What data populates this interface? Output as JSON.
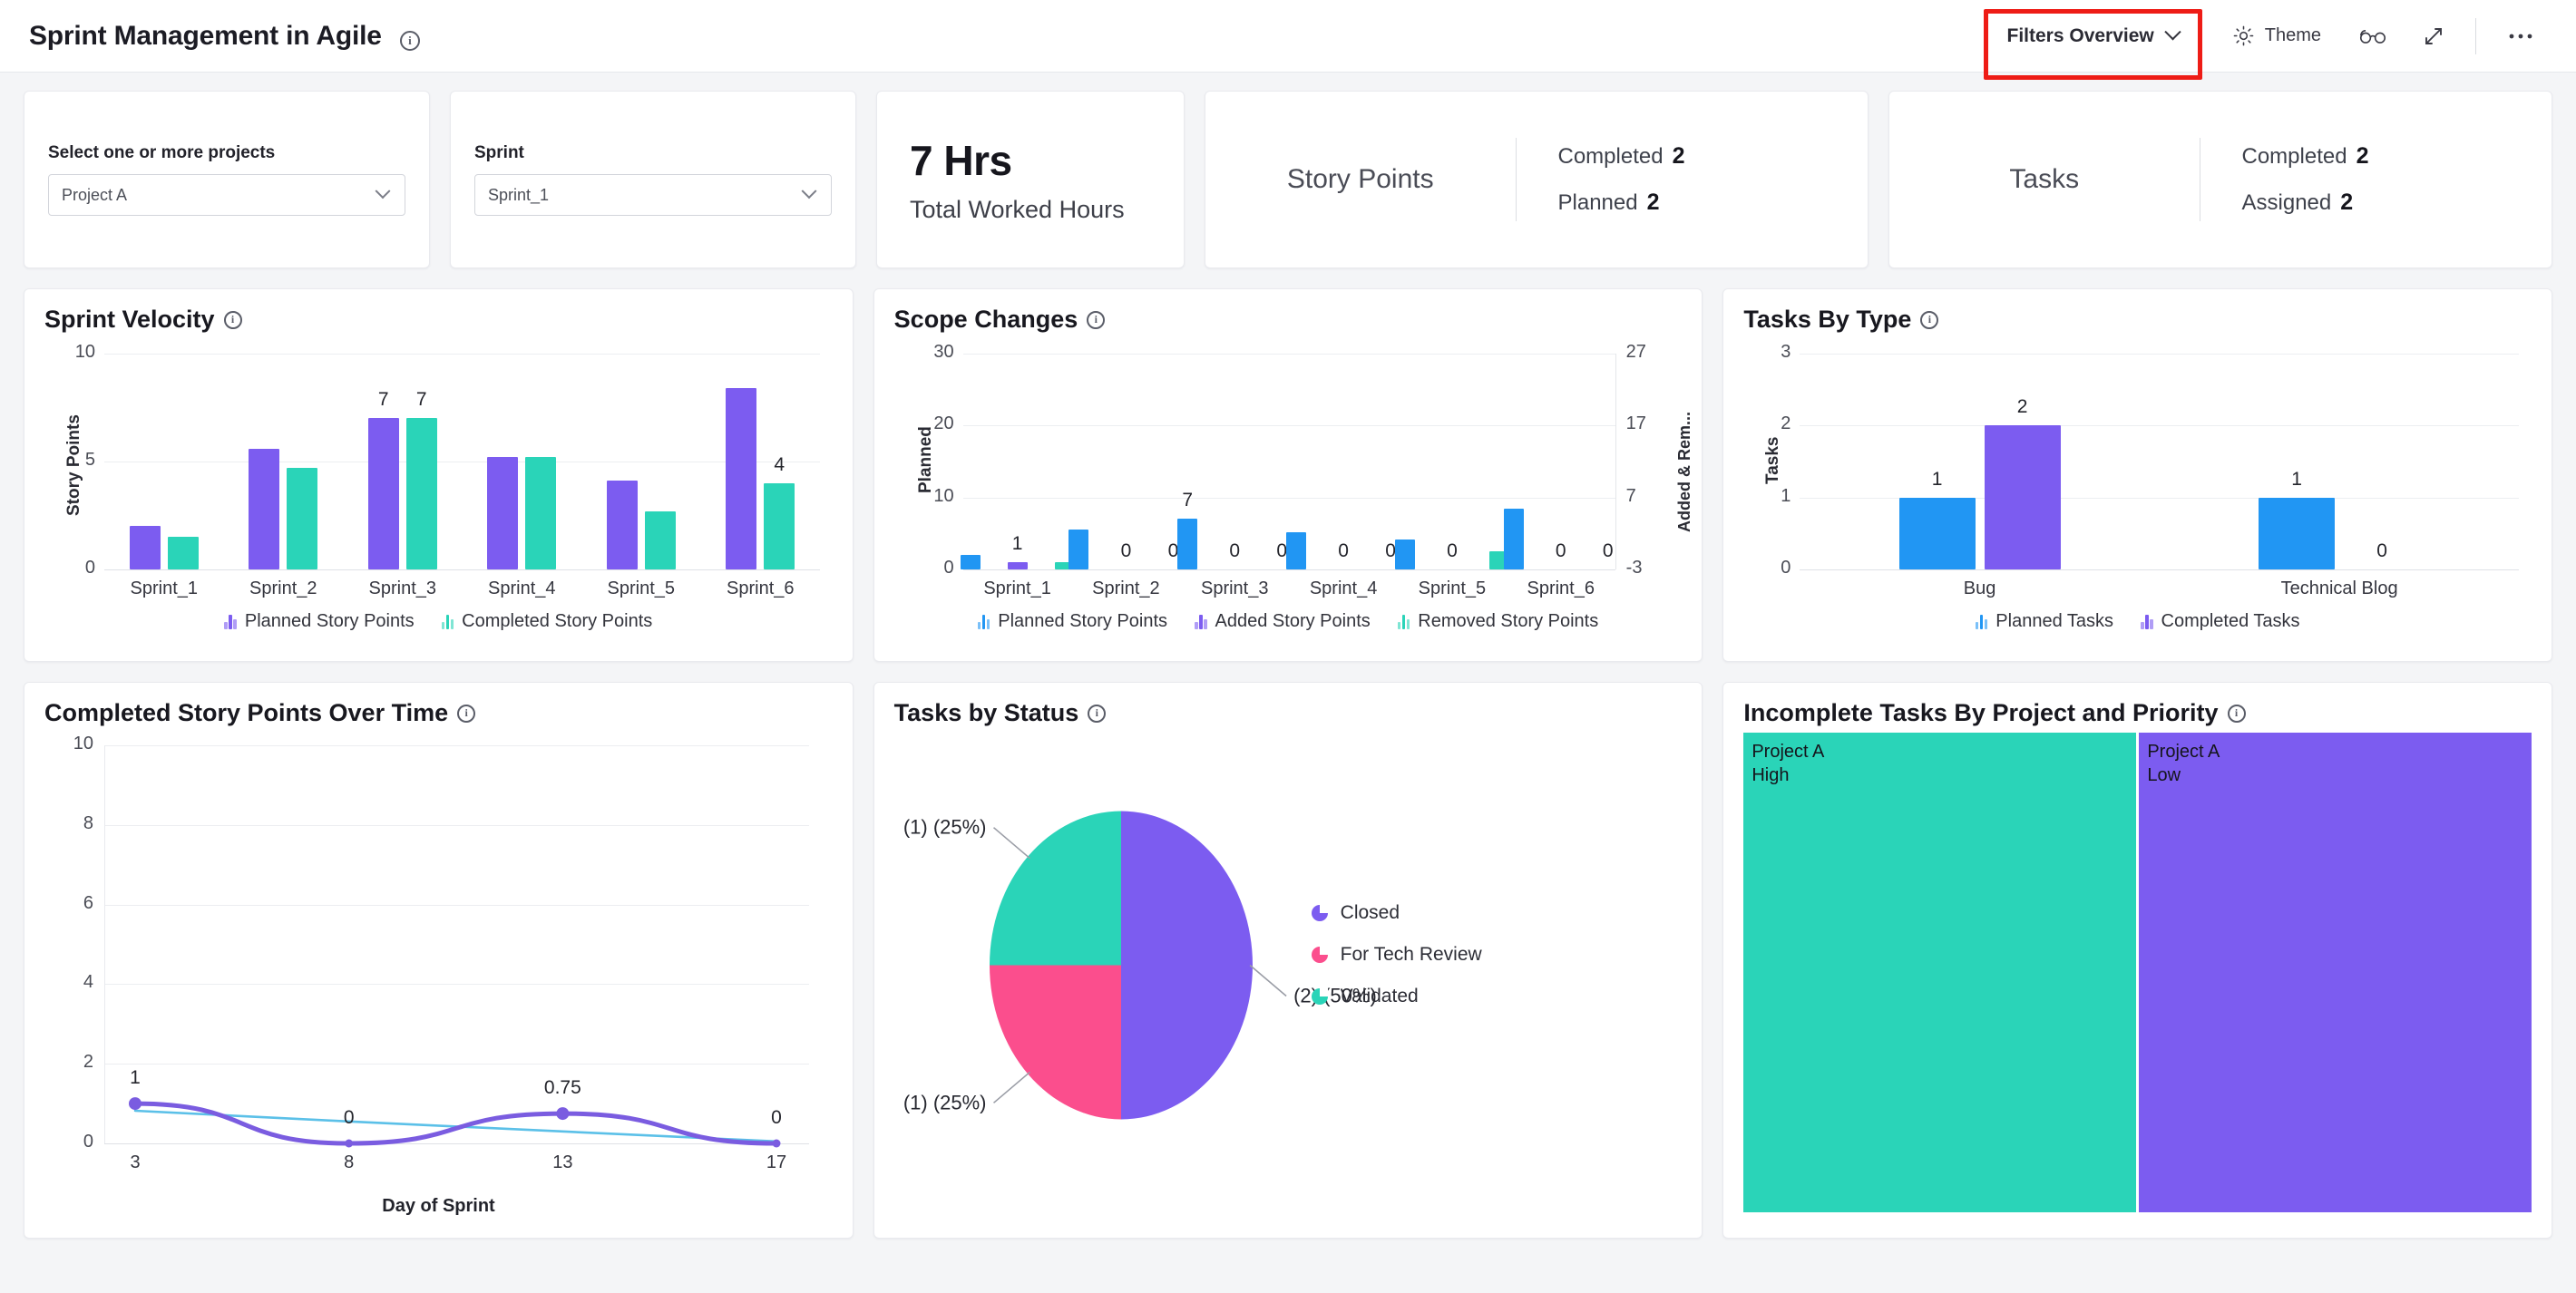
{
  "header": {
    "title": "Sprint Management in Agile",
    "filters_label": "Filters Overview",
    "theme_label": "Theme",
    "icons": {
      "info": "info-icon",
      "sun": "sun-icon",
      "glasses": "glasses-icon",
      "expand": "expand-icon",
      "more": "more-icon"
    }
  },
  "filters": [
    {
      "label": "Select one or more projects",
      "value": "Project A"
    },
    {
      "label": "Sprint",
      "value": "Sprint_1"
    }
  ],
  "kpis": {
    "hours": {
      "value": "7 Hrs",
      "caption": "Total Worked Hours"
    },
    "story_points": {
      "name": "Story Points",
      "rows": [
        {
          "label": "Completed",
          "value": "2"
        },
        {
          "label": "Planned",
          "value": "2"
        }
      ]
    },
    "tasks": {
      "name": "Tasks",
      "rows": [
        {
          "label": "Completed",
          "value": "2"
        },
        {
          "label": "Assigned",
          "value": "2"
        }
      ]
    }
  },
  "colors": {
    "purple": "#7c5cf0",
    "teal": "#2ad4b8",
    "blue": "#2196f3",
    "pink": "#fb4e8d",
    "line_blue": "#5bc0e8",
    "line_purple": "#7a5ce0",
    "accent_red": "#ee1c16"
  },
  "chart_data": [
    {
      "id": "sprint_velocity",
      "type": "bar",
      "title": "Sprint Velocity",
      "xlabel": "",
      "ylabel": "Story Points",
      "ylim": [
        0,
        10
      ],
      "yticks": [
        0,
        5,
        10
      ],
      "categories": [
        "Sprint_1",
        "Sprint_2",
        "Sprint_3",
        "Sprint_4",
        "Sprint_5",
        "Sprint_6"
      ],
      "series": [
        {
          "name": "Planned Story Points",
          "color": "#7c5cf0",
          "values": [
            2,
            5.6,
            7,
            5.2,
            4.1,
            8.4
          ],
          "labels": [
            "",
            "",
            "7",
            "",
            "",
            ""
          ]
        },
        {
          "name": "Completed Story Points",
          "color": "#2ad4b8",
          "values": [
            1.5,
            4.7,
            7,
            5.2,
            2.7,
            4
          ],
          "labels": [
            "",
            "",
            "7",
            "",
            "",
            "4"
          ]
        }
      ]
    },
    {
      "id": "scope_changes",
      "type": "bar",
      "title": "Scope Changes",
      "ylabel": "Planned",
      "y2label": "Added & Rem...",
      "ylim": [
        0,
        30
      ],
      "yticks": [
        0,
        10,
        20,
        30
      ],
      "y2ticks": [
        -3,
        7,
        17,
        27
      ],
      "categories": [
        "Sprint_1",
        "Sprint_2",
        "Sprint_3",
        "Sprint_4",
        "Sprint_5",
        "Sprint_6"
      ],
      "series": [
        {
          "name": "Planned Story Points",
          "color": "#2196f3",
          "values": [
            2,
            5.6,
            7,
            5.2,
            4.1,
            8.4
          ],
          "labels": [
            "",
            "",
            "7",
            "",
            "",
            ""
          ]
        },
        {
          "name": "Added Story Points",
          "color": "#7c5cf0",
          "values": [
            1,
            0,
            0,
            0,
            0,
            0
          ],
          "labels": [
            "1",
            "0",
            "0",
            "0",
            "0",
            "0"
          ]
        },
        {
          "name": "Removed Story Points",
          "color": "#2ad4b8",
          "values": [
            1,
            0,
            0,
            0,
            2.5,
            0
          ],
          "labels": [
            "",
            "0",
            "0",
            "0",
            "",
            "0"
          ]
        }
      ]
    },
    {
      "id": "tasks_by_type",
      "type": "bar",
      "title": "Tasks By Type",
      "ylabel": "Tasks",
      "ylim": [
        0,
        3
      ],
      "yticks": [
        0,
        1,
        2,
        3
      ],
      "categories": [
        "Bug",
        "Technical Blog"
      ],
      "series": [
        {
          "name": "Planned Tasks",
          "color": "#2196f3",
          "values": [
            1,
            1
          ],
          "labels": [
            "1",
            "1"
          ]
        },
        {
          "name": "Completed Tasks",
          "color": "#7c5cf0",
          "values": [
            2,
            0
          ],
          "labels": [
            "2",
            "0"
          ]
        }
      ]
    },
    {
      "id": "completed_story_points_over_time",
      "type": "line",
      "title": "Completed Story Points Over Time",
      "xlabel": "Day of Sprint",
      "ylim": [
        0,
        10
      ],
      "yticks": [
        0,
        2,
        4,
        6,
        8,
        10
      ],
      "x": [
        3,
        8,
        13,
        17
      ],
      "series": [
        {
          "name": "Completed Story Points",
          "color": "#7a5ce0",
          "values": [
            1,
            0,
            0.75,
            0
          ],
          "labels": [
            "1",
            "0",
            "0.75",
            "0"
          ]
        },
        {
          "name": "Trend",
          "color": "#5bc0e8",
          "values": [
            0.82,
            0.55,
            0.3,
            0.05
          ],
          "labels": [
            "",
            "",
            "",
            ""
          ]
        }
      ]
    },
    {
      "id": "tasks_by_status",
      "type": "pie",
      "title": "Tasks by Status",
      "slices": [
        {
          "name": "Closed",
          "color": "#7c5cf0",
          "count": 2,
          "percent": 50,
          "label": "(2) (50%)"
        },
        {
          "name": "For Tech Review",
          "color": "#fb4e8d",
          "count": 1,
          "percent": 25,
          "label": "(1) (25%)"
        },
        {
          "name": "Validated",
          "color": "#2ad4b8",
          "count": 1,
          "percent": 25,
          "label": "(1) (25%)"
        }
      ],
      "legend_position": "right"
    },
    {
      "id": "incomplete_tasks_by_project_and_priority",
      "type": "treemap",
      "title": "Incomplete Tasks By Project and Priority",
      "cells": [
        {
          "project": "Project A",
          "priority": "High",
          "color": "#2ad4b8",
          "weight": 1
        },
        {
          "project": "Project A",
          "priority": "Low",
          "color": "#7c5cf0",
          "weight": 1
        }
      ]
    }
  ]
}
